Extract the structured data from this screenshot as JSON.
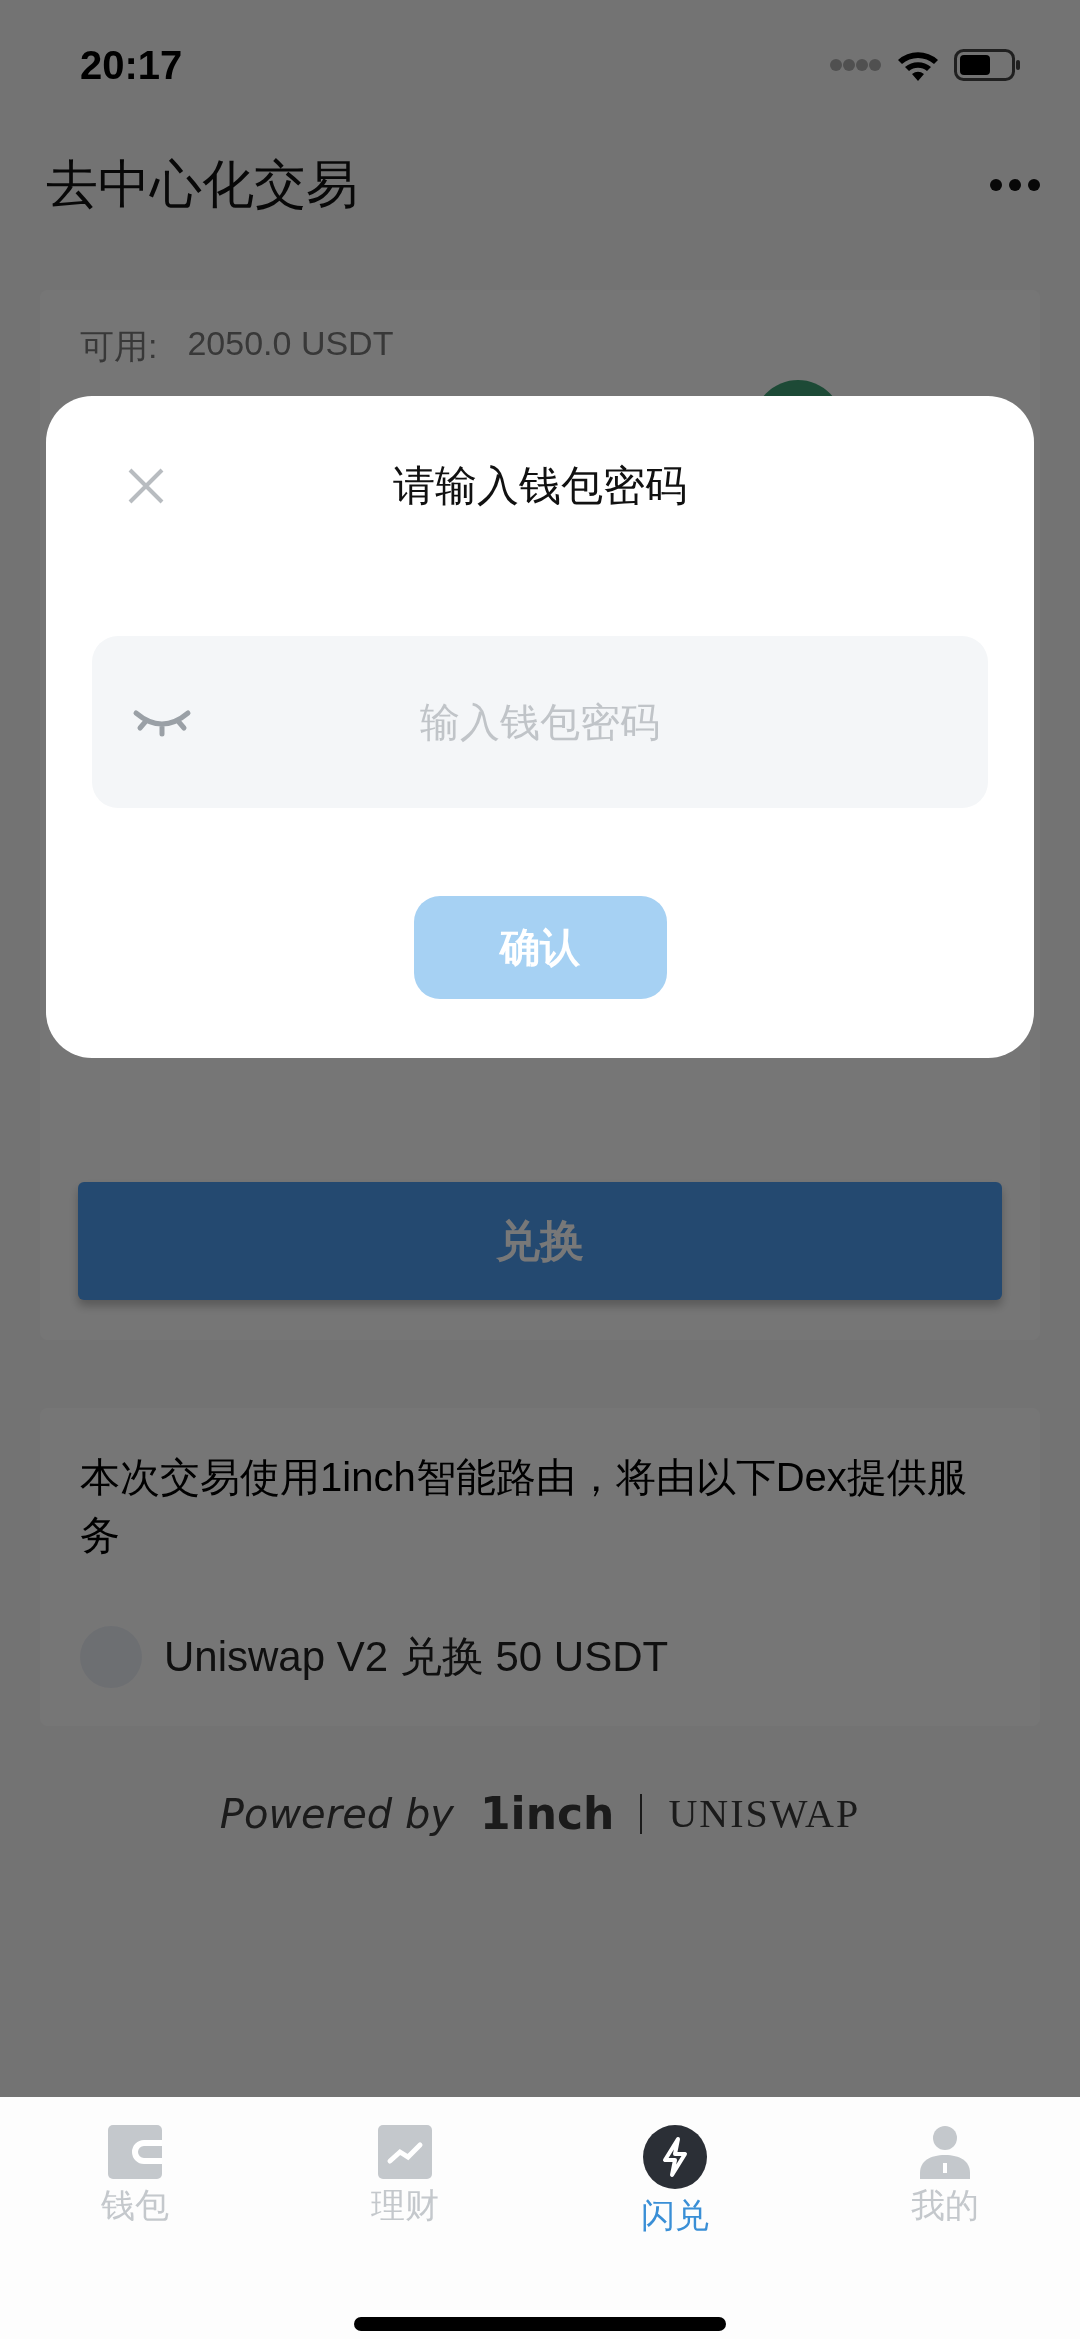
{
  "status_bar": {
    "time": "20:17"
  },
  "header": {
    "title": "去中心化交易"
  },
  "swap_card": {
    "available_label": "可用:",
    "available_value": "2050.0 USDT",
    "button": "兑换"
  },
  "route_card": {
    "description": "本次交易使用1inch智能路由，将由以下Dex提供服务",
    "dexes": [
      {
        "label": "Uniswap V2 兑换 50 USDT"
      }
    ]
  },
  "powered_by": {
    "prefix": "Powered by",
    "brand": "1inch",
    "partner": "UNISWAP"
  },
  "dialog": {
    "title": "请输入钱包密码",
    "password_field": {
      "placeholder": "输入钱包密码",
      "visible": false
    },
    "confirm": {
      "label": "确认",
      "disabled": true
    }
  },
  "tabs": [
    {
      "kind": "wallet",
      "label": "钱包",
      "selected": false
    },
    {
      "kind": "finance",
      "label": "理财",
      "selected": false
    },
    {
      "kind": "swap",
      "label": "闪兑",
      "selected": true
    },
    {
      "kind": "profile",
      "label": "我的",
      "selected": false
    }
  ]
}
